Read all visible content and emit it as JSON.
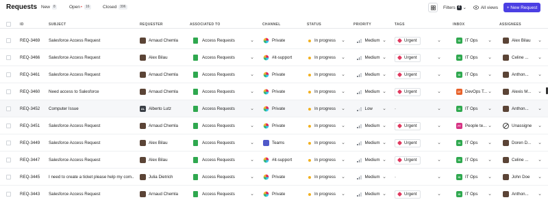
{
  "header": {
    "title": "Requests",
    "tabs": [
      {
        "label": "New",
        "count": "8"
      },
      {
        "label": "Open",
        "count": "16",
        "dot": "•"
      },
      {
        "label": "Closed",
        "count": "396"
      }
    ],
    "filters_label": "Filters",
    "filters_count": "4",
    "all_views_label": "All views",
    "new_request_label": "+ New Request"
  },
  "columns": [
    "ID",
    "SUBJECT",
    "REQUESTER",
    "ASSOCIATED TO",
    "CHANNEL",
    "STATUS",
    "PRIORITY",
    "TAGS",
    "INBOX",
    "ASSIGNEES"
  ],
  "rows": [
    {
      "id": "REQ-3469",
      "subject": "Salesforce Access Request",
      "requester": "Arnaud Chemla",
      "req_avatar": "photo",
      "assoc": "Access Requests",
      "channel": "Private",
      "channel_icon": "slack",
      "status": "In progress",
      "priority": "Medium",
      "tag": "Urgent",
      "inbox": "IT Ops",
      "inbox_code": "IO",
      "inbox_color": "itops",
      "assignee": "Alex Bilau",
      "asg_icon": "photo"
    },
    {
      "id": "REQ-3466",
      "subject": "Salesforce Access Request",
      "requester": "Alex Bilau",
      "req_avatar": "photo",
      "assoc": "Access Requests",
      "channel": "#it-support",
      "channel_icon": "slack",
      "status": "In progress",
      "priority": "Medium",
      "tag": "Urgent",
      "inbox": "IT Ops",
      "inbox_code": "IO",
      "inbox_color": "itops",
      "assignee": "Celine ...",
      "asg_icon": "photo"
    },
    {
      "id": "REQ-3461",
      "subject": "Salesforce Access Request",
      "requester": "Arnaud Chemla",
      "req_avatar": "photo",
      "assoc": "Access Requests",
      "channel": "Private",
      "channel_icon": "slack",
      "status": "In progress",
      "priority": "Medium",
      "tag": "Urgent",
      "inbox": "IT Ops",
      "inbox_code": "IO",
      "inbox_color": "itops",
      "assignee": "Anthon...",
      "asg_icon": "photo"
    },
    {
      "id": "REQ-3460",
      "subject": "Need access to Salesforce",
      "requester": "Arnaud Chemla",
      "req_avatar": "photo",
      "assoc": "Access Requests",
      "channel": "Private",
      "channel_icon": "slack",
      "status": "In progress",
      "priority": "Medium",
      "tag": "Urgent",
      "inbox": "DevOps T...",
      "inbox_code": "DT",
      "inbox_color": "devops",
      "assignee": "Alexis M...",
      "asg_icon": "photo"
    },
    {
      "id": "REQ-3452",
      "subject": "Computer Issue",
      "requester": "Alberto Lutz",
      "req_avatar": "initials",
      "req_initials": "AL",
      "assoc": "Access Requests",
      "channel": "Private",
      "channel_icon": "slack",
      "status": "In progress",
      "priority": "Low",
      "tag": "-",
      "inbox": "IT Ops",
      "inbox_code": "IO",
      "inbox_color": "itops",
      "assignee": "Anthon...",
      "asg_icon": "photo"
    },
    {
      "id": "REQ-3451",
      "subject": "Salesforce Access Request",
      "requester": "Arnaud Chemla",
      "req_avatar": "photo",
      "assoc": "Access Requests",
      "channel": "Private",
      "channel_icon": "slack",
      "status": "In progress",
      "priority": "Medium",
      "tag": "Urgent",
      "inbox": "People te...",
      "inbox_code": "PT",
      "inbox_color": "people",
      "assignee": "Unassigned",
      "asg_icon": "unassigned"
    },
    {
      "id": "REQ-3449",
      "subject": "Salesforce Access Request",
      "requester": "Alex Bilau",
      "req_avatar": "photo",
      "assoc": "Access Requests",
      "channel": "Teams",
      "channel_icon": "teams",
      "status": "In progress",
      "priority": "Medium",
      "tag": "Urgent",
      "inbox": "IT Ops",
      "inbox_code": "IO",
      "inbox_color": "itops",
      "assignee": "Doren D...",
      "asg_icon": "photo"
    },
    {
      "id": "REQ-3447",
      "subject": "Salesforce Access Request",
      "requester": "Alex Bilau",
      "req_avatar": "photo",
      "assoc": "Access Requests",
      "channel": "#it-support",
      "channel_icon": "slack",
      "status": "In progress",
      "priority": "Medium",
      "tag": "Urgent",
      "inbox": "IT Ops",
      "inbox_code": "IO",
      "inbox_color": "itops",
      "assignee": "Celine ...",
      "asg_icon": "photo"
    },
    {
      "id": "REQ-3445",
      "subject": "I need to create a ticket please help my com...",
      "requester": "Julia Dietrich",
      "req_avatar": "photo",
      "assoc": "Access Requests",
      "channel": "Private",
      "channel_icon": "slack",
      "status": "In progress",
      "priority": "Medium",
      "tag": "-",
      "inbox": "IT Ops",
      "inbox_code": "IO",
      "inbox_color": "itops",
      "assignee": "John Doe",
      "asg_icon": "photo"
    },
    {
      "id": "REQ-3443",
      "subject": "Salesforce Access Request",
      "requester": "Arnaud Chemla",
      "req_avatar": "photo",
      "assoc": "Access Requests",
      "channel": "Private",
      "channel_icon": "slack",
      "status": "In progress",
      "priority": "Medium",
      "tag": "Urgent",
      "inbox": "IT Ops",
      "inbox_code": "IO",
      "inbox_color": "itops",
      "assignee": "Anthon...",
      "asg_icon": "photo"
    }
  ],
  "colors": {
    "accent": "#4b3fe3",
    "status_in_progress": "#f2b01e",
    "tag_urgent": "#e0395f",
    "inbox_itops": "#2fa84f",
    "inbox_devops": "#e8622b",
    "inbox_people": "#d63384"
  }
}
